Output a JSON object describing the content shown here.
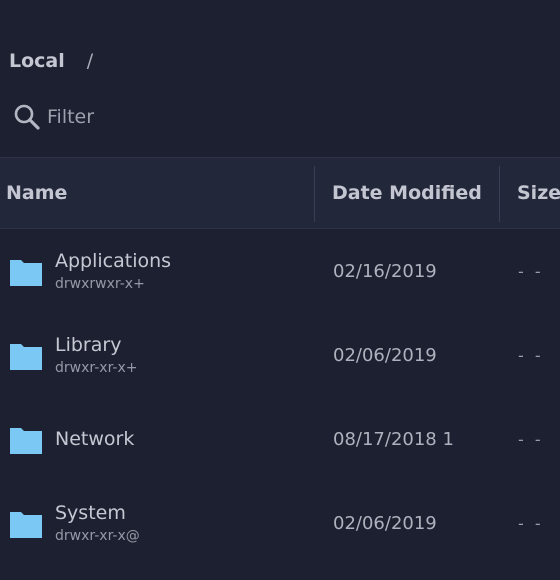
{
  "breadcrumb": {
    "root": "Local",
    "separator": "/"
  },
  "filter": {
    "icon": "search-icon",
    "placeholder": "Filter"
  },
  "columns": {
    "name": "Name",
    "date_modified": "Date Modified",
    "size": "Size"
  },
  "files": [
    {
      "name": "Applications",
      "permissions": "drwxrwxr-x+",
      "date": "02/16/2019",
      "size": "- -",
      "icon": "folder-icon"
    },
    {
      "name": "Library",
      "permissions": "drwxr-xr-x+",
      "date": "02/06/2019",
      "size": "- -",
      "icon": "folder-icon"
    },
    {
      "name": "Network",
      "permissions": "",
      "date": "08/17/2018 1",
      "size": "- -",
      "icon": "folder-icon"
    },
    {
      "name": "System",
      "permissions": "drwxr-xr-x@",
      "date": "02/06/2019",
      "size": "- -",
      "icon": "folder-icon"
    }
  ],
  "colors": {
    "background": "#1d2030",
    "header_background": "#23273a",
    "folder": "#7cc8f5"
  }
}
